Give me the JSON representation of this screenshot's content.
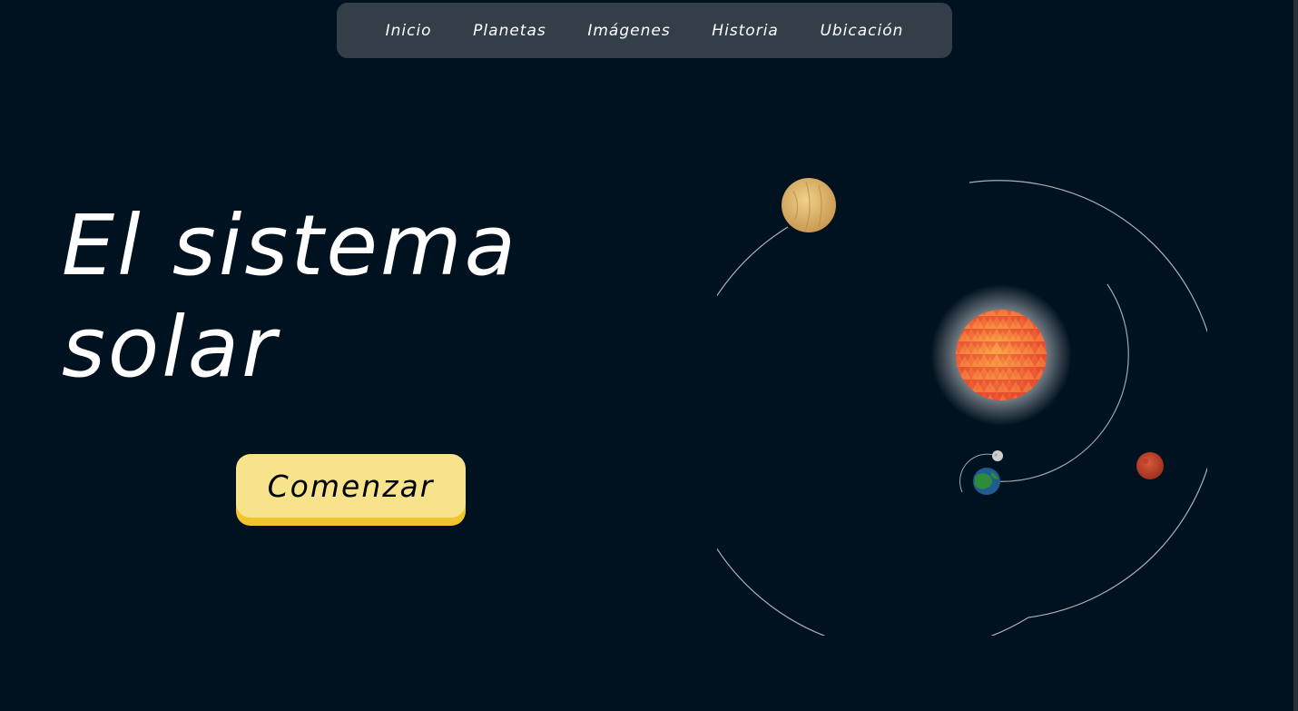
{
  "nav": {
    "items": [
      {
        "label": "Inicio"
      },
      {
        "label": "Planetas"
      },
      {
        "label": "Imágenes"
      },
      {
        "label": "Historia"
      },
      {
        "label": "Ubicación"
      }
    ]
  },
  "hero": {
    "title_line1": "El sistema",
    "title_line2": "solar",
    "cta_label": "Comenzar"
  },
  "colors": {
    "background": "#00111f",
    "nav_background": "#343e48",
    "cta_background": "#f6e38c",
    "cta_shadow": "#f2c42e",
    "sun": "#f26b3a",
    "venus": "#d8b36a",
    "earth_ocean": "#1f5d8f",
    "earth_land": "#2e8b3a",
    "mars": "#c2412a",
    "moon": "#cfcfcf"
  },
  "illustration": {
    "bodies": [
      "sun",
      "venus",
      "earth",
      "moon",
      "mars"
    ]
  }
}
